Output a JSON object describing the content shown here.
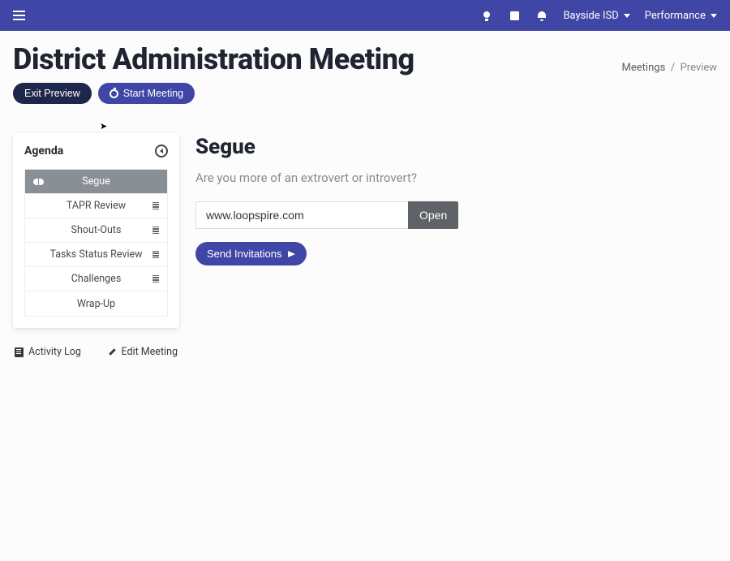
{
  "navbar": {
    "org": "Bayside ISD",
    "menu": "Performance"
  },
  "page": {
    "title": "District Administration Meeting"
  },
  "breadcrumb": {
    "parent": "Meetings",
    "sep": "/",
    "current": "Preview"
  },
  "actions": {
    "exit": "Exit Preview",
    "start": "Start Meeting"
  },
  "agenda": {
    "title": "Agenda",
    "items": [
      {
        "label": "Segue",
        "active": true,
        "icon": "brain",
        "handle": false
      },
      {
        "label": "TAPR Review",
        "active": false,
        "handle": true
      },
      {
        "label": "Shout-Outs",
        "active": false,
        "handle": true
      },
      {
        "label": "Tasks Status Review",
        "active": false,
        "handle": true
      },
      {
        "label": "Challenges",
        "active": false,
        "handle": true
      },
      {
        "label": "Wrap-Up",
        "active": false,
        "handle": false
      }
    ],
    "footer": {
      "activity_log": "Activity Log",
      "edit_meeting": "Edit Meeting"
    }
  },
  "main": {
    "heading": "Segue",
    "question": "Are you more of an extrovert or introvert?",
    "url_value": "www.loopspire.com",
    "open_label": "Open",
    "send_label": "Send Invitations"
  }
}
